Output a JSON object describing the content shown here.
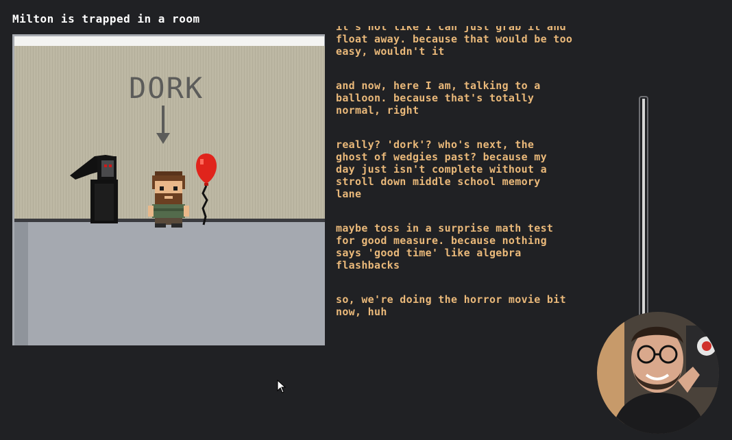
{
  "header": {
    "title": "Milton is trapped in a room"
  },
  "game": {
    "wall_text": "DORK"
  },
  "transcript": {
    "messages": [
      "it's not like I can just grab it and\nfloat away. because that would be too\neasy, wouldn't it",
      "and now, here I am, talking to a\nballoon. because that's totally\nnormal, right",
      "really? 'dork'? who's next, the\nghost of wedgies past? because my\nday just isn't complete without a\nstroll down middle school memory\nlane",
      "maybe toss in a surprise math test\nfor good measure. because nothing\nsays 'good time' like algebra\nflashbacks",
      "so, we're doing the horror movie bit\nnow, huh"
    ]
  },
  "colors": {
    "background": "#202124",
    "transcript_text": "#eab97a",
    "wall": "#bdb8a4",
    "floor": "#a5a9b0",
    "balloon": "#e0241c"
  },
  "icons": [
    "mouse-cursor-icon",
    "balloon-icon",
    "arrow-down-icon"
  ]
}
